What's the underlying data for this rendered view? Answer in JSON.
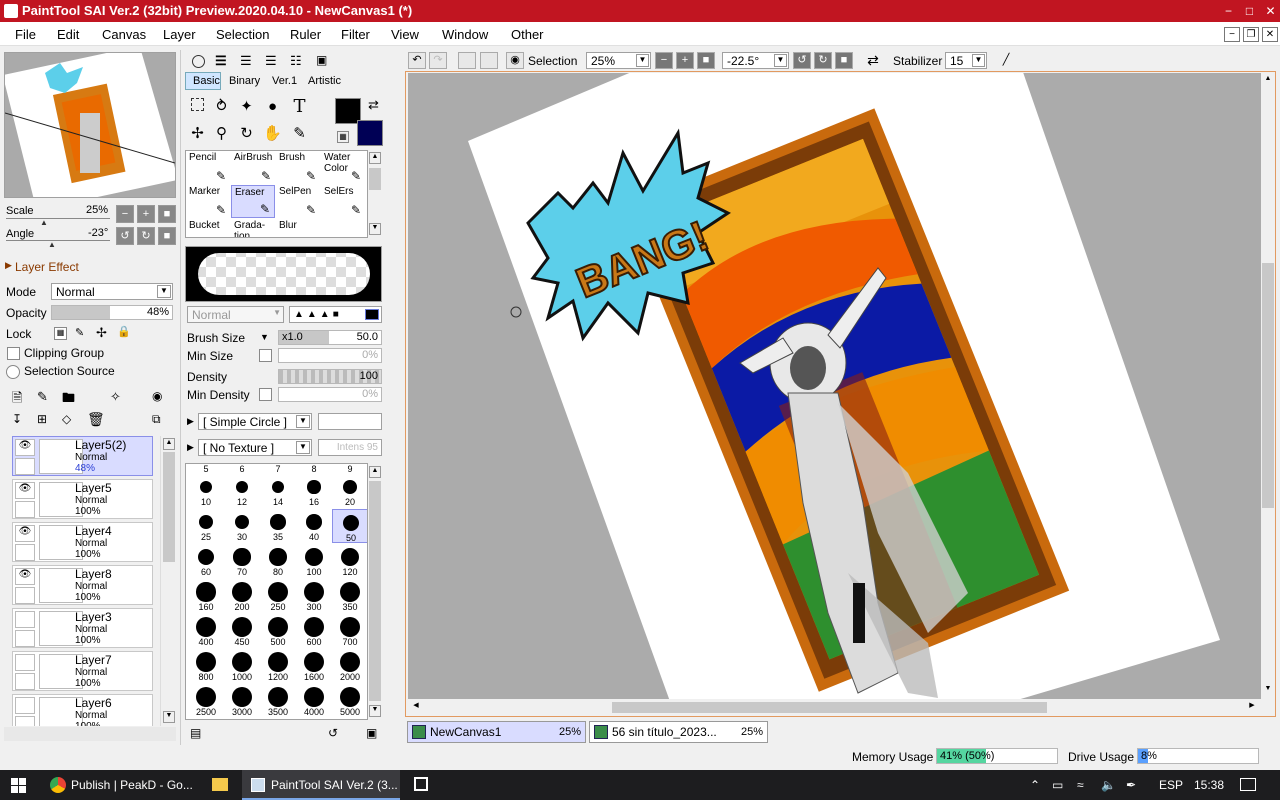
{
  "window": {
    "title": "PaintTool SAI Ver.2 (32bit) Preview.2020.04.10 - NewCanvas1 (*)",
    "min": "−",
    "max": "□",
    "close": "✕"
  },
  "menu": [
    "File",
    "Edit",
    "Canvas",
    "Layer",
    "Selection",
    "Ruler",
    "Filter",
    "View",
    "Window",
    "Other"
  ],
  "navigator": {
    "scale_label": "Scale",
    "scale_value": "25%",
    "angle_label": "Angle",
    "angle_value": "-23°"
  },
  "layer_effect": {
    "title": "Layer Effect",
    "mode_label": "Mode",
    "mode_value": "Normal",
    "opacity_label": "Opacity",
    "opacity_value": "48%",
    "opacity_level": 0.48,
    "lock_label": "Lock",
    "clipping_label": "Clipping Group",
    "selection_source_label": "Selection Source"
  },
  "layers": [
    {
      "name": "Layer5(2)",
      "mode": "Normal",
      "opacity": "48%",
      "visible": true,
      "selected": true
    },
    {
      "name": "Layer5",
      "mode": "Normal",
      "opacity": "100%",
      "visible": true,
      "selected": false
    },
    {
      "name": "Layer4",
      "mode": "Normal",
      "opacity": "100%",
      "visible": true,
      "selected": false
    },
    {
      "name": "Layer8",
      "mode": "Normal",
      "opacity": "100%",
      "visible": true,
      "selected": false
    },
    {
      "name": "Layer3",
      "mode": "Normal",
      "opacity": "100%",
      "visible": false,
      "selected": false
    },
    {
      "name": "Layer7",
      "mode": "Normal",
      "opacity": "100%",
      "visible": false,
      "selected": false
    },
    {
      "name": "Layer6",
      "mode": "Normal",
      "opacity": "100%",
      "visible": false,
      "selected": false
    }
  ],
  "tool_tabs": [
    "Basic",
    "Binary",
    "Ver.1",
    "Artistic"
  ],
  "brushes": [
    "Pencil",
    "AirBrush",
    "Brush",
    "Water Color",
    "Marker",
    "Eraser",
    "SelPen",
    "SelErs",
    "Bucket",
    "Grada-tion",
    "Blur"
  ],
  "selected_brush": "Eraser",
  "brush_settings": {
    "blend_value": "Normal",
    "size_label": "Brush Size",
    "size_mult": "x1.0",
    "size_value": "50.0",
    "min_size_label": "Min Size",
    "min_size_value": "0%",
    "density_label": "Density",
    "density_value": "100",
    "min_density_label": "Min Density",
    "min_density_value": "0%",
    "shape_value": "[ Simple Circle ]",
    "texture_value": "[ No Texture ]",
    "intens_value": "Intens 95"
  },
  "size_header": [
    "5",
    "6",
    "7",
    "8",
    "9"
  ],
  "size_presets": [
    "10",
    "12",
    "14",
    "16",
    "20",
    "25",
    "30",
    "35",
    "40",
    "50",
    "60",
    "70",
    "80",
    "100",
    "120",
    "160",
    "200",
    "250",
    "300",
    "350",
    "400",
    "450",
    "500",
    "600",
    "700",
    "800",
    "1000",
    "1200",
    "1600",
    "2000",
    "2500",
    "3000",
    "3500",
    "4000",
    "5000"
  ],
  "selected_size": "50",
  "toolbar": {
    "selection_label": "Selection",
    "zoom_value": "25%",
    "angle_value": "-22.5°",
    "stabilizer_label": "Stabilizer",
    "stabilizer_value": "15"
  },
  "canvas": {
    "comic_text": "BANG!"
  },
  "tabs": [
    {
      "name": "NewCanvas1",
      "zoom": "25%"
    },
    {
      "name": "56 sin título_2023...",
      "zoom": "25%"
    }
  ],
  "status": {
    "memory_label": "Memory Usage",
    "memory_value": "41% (50%)",
    "memory_level": 0.41,
    "drive_label": "Drive Usage",
    "drive_value": "8%",
    "drive_level": 0.08
  },
  "taskbar": {
    "app1": "Publish | PeakD - Go...",
    "app2": "PaintTool SAI Ver.2 (3...",
    "lang": "ESP",
    "time": "15:38"
  },
  "colors": {
    "title_bar": "#c11521",
    "foreground": "#000000",
    "background": "#000055",
    "selection_highlight": "#d9dcff",
    "memory_bar": "#55d6a0",
    "drive_bar": "#5aa0ff",
    "speech_bubble": "#5ccfea"
  }
}
